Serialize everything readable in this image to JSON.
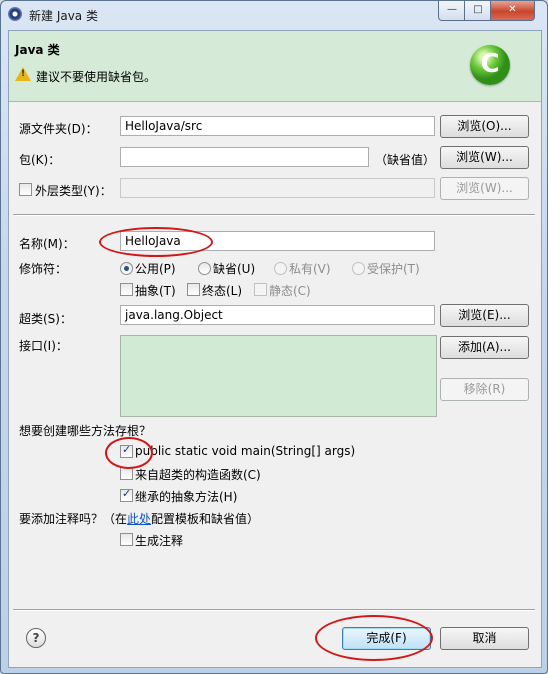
{
  "window": {
    "title": "新建 Java 类",
    "controls": {
      "minimize": "—",
      "maximize": "□",
      "close": "✕"
    }
  },
  "banner": {
    "title": "Java 类",
    "message": "建议不要使用缺省包。",
    "warning_icon": "warning-icon",
    "logo_icon": "java-class-logo",
    "logo_letter": "C"
  },
  "form": {
    "source_folder": {
      "label": "源文件夹(D)：",
      "value": "HelloJava/src",
      "browse": "浏览(O)..."
    },
    "package": {
      "label": "包(K)：",
      "value": "",
      "default_note": "（缺省值）",
      "browse": "浏览(W)..."
    },
    "enclosing": {
      "label": "外层类型(Y)：",
      "value": "",
      "checked": false,
      "browse": "浏览(W)..."
    },
    "name": {
      "label": "名称(M)：",
      "value": "HelloJava"
    },
    "modifiers": {
      "label": "修饰符：",
      "access": [
        {
          "label": "公用(P)",
          "selected": true,
          "enabled": true
        },
        {
          "label": "缺省(U)",
          "selected": false,
          "enabled": true
        },
        {
          "label": "私有(V)",
          "selected": false,
          "enabled": false
        },
        {
          "label": "受保护(T)",
          "selected": false,
          "enabled": false
        }
      ],
      "flags": [
        {
          "label": "抽象(T)",
          "checked": false,
          "enabled": true
        },
        {
          "label": "终态(L)",
          "checked": false,
          "enabled": true
        },
        {
          "label": "静态(C)",
          "checked": false,
          "enabled": false
        }
      ]
    },
    "superclass": {
      "label": "超类(S)：",
      "value": "java.lang.Object",
      "browse": "浏览(E)..."
    },
    "interfaces": {
      "label": "接口(I)：",
      "add": "添加(A)...",
      "remove": "移除(R)",
      "items": []
    },
    "stubs": {
      "question": "想要创建哪些方法存根？",
      "options": [
        {
          "label": "public static void main(String[] args)",
          "checked": true
        },
        {
          "label": "来自超类的构造函数(C)",
          "checked": false
        },
        {
          "label": "继承的抽象方法(H)",
          "checked": true
        }
      ]
    },
    "comments": {
      "question_prefix": "要添加注释吗？（在",
      "link": "此处",
      "question_suffix": "配置模板和缺省值）",
      "generate": {
        "label": "生成注释",
        "checked": false
      }
    }
  },
  "footer": {
    "help_icon": "?",
    "finish": "完成(F)",
    "cancel": "取消"
  },
  "colors": {
    "banner_bg": "#d6ead8",
    "list_bg": "#d0ead4",
    "annotation_red": "#d01818",
    "link": "#0e54c6"
  }
}
